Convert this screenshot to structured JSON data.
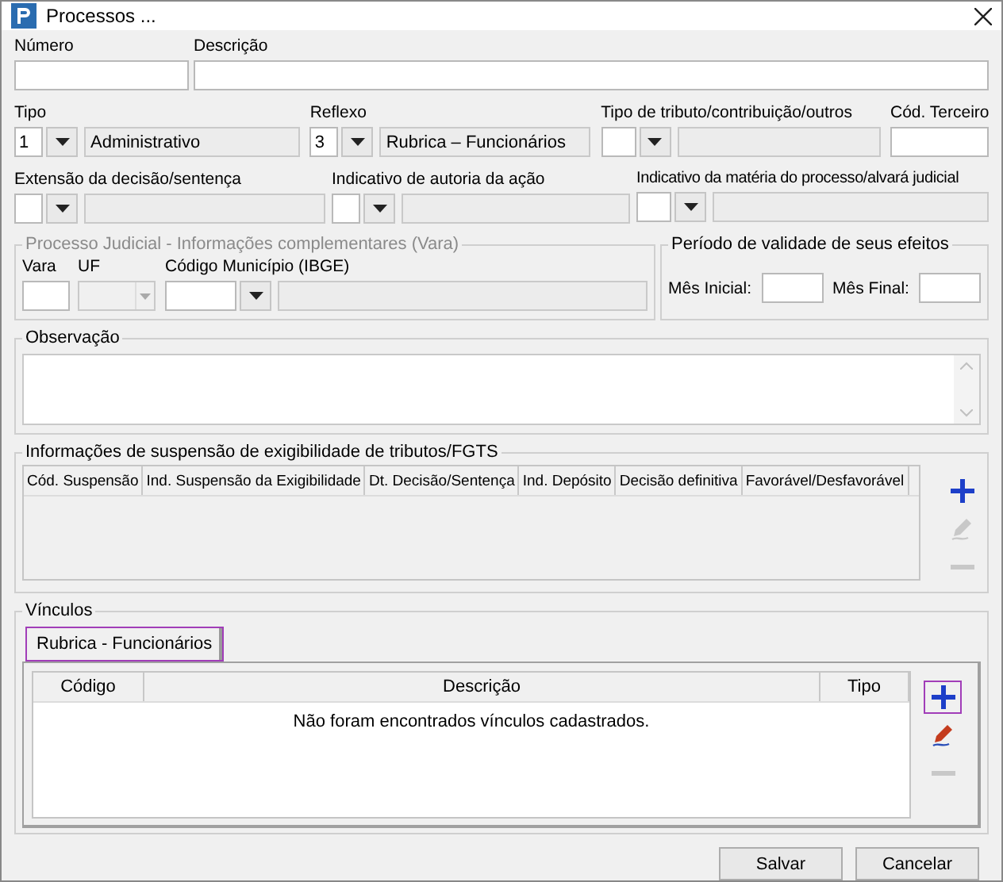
{
  "window": {
    "title": "Processos ..."
  },
  "identification": [
    {
      "label": "Número"
    },
    {
      "label": "Descrição"
    }
  ],
  "row_type": [
    {
      "label": "Tipo",
      "kind": "combo",
      "code": "1",
      "description": "Administrativo"
    },
    {
      "label": "Reflexo",
      "kind": "combo",
      "code": "3",
      "description": "Rubrica – Funcionários"
    },
    {
      "label": "Tipo de tributo/contribuição/outros",
      "kind": "combo"
    },
    {
      "label": "Cód. Terceiro",
      "kind": "text"
    }
  ],
  "row_decision": [
    {
      "label": "Extensão da decisão/sentença",
      "kind": "combo"
    },
    {
      "label": "Indicativo de autoria da ação",
      "kind": "combo"
    },
    {
      "label": "Indicativo da matéria do processo/alvará judicial",
      "kind": "combo"
    }
  ],
  "judicial": {
    "title": "Processo Judicial - Informações complementares (Vara)",
    "disabled": true,
    "fields": [
      {
        "label": "Vara",
        "kind": "text"
      },
      {
        "label": "UF",
        "kind": "select",
        "disabled": true
      },
      {
        "label": "Código Município (IBGE)",
        "kind": "combo"
      }
    ]
  },
  "validity": {
    "title": "Período de validade de seus efeitos",
    "fields": [
      {
        "label": "Mês Inicial:"
      },
      {
        "label": "Mês Final:"
      }
    ]
  },
  "observation": {
    "title": "Observação"
  },
  "suspension": {
    "title": "Informações de suspensão de exigibilidade de tributos/FGTS",
    "columns": [
      "Cód. Suspensão",
      "Ind. Suspensão da Exigibilidade",
      "Dt. Decisão/Sentença",
      "Ind. Depósito",
      "Decisão definitiva",
      "Favorável/Desfavorável"
    ],
    "actions": [
      {
        "kind": "add",
        "disabled": false,
        "highlighted": false
      },
      {
        "kind": "edit",
        "disabled": true,
        "highlighted": false
      },
      {
        "kind": "remove",
        "disabled": true,
        "highlighted": false
      }
    ]
  },
  "links": {
    "title": "Vínculos",
    "tabs": [
      {
        "label": "Rubrica - Funcionários",
        "selected": true,
        "highlighted": true
      }
    ],
    "columns": [
      "Código",
      "Descrição",
      "Tipo"
    ],
    "empty_message": "Não foram encontrados vínculos cadastrados.",
    "actions": [
      {
        "kind": "add",
        "disabled": false,
        "highlighted": true
      },
      {
        "kind": "edit",
        "disabled": false,
        "highlighted": false
      },
      {
        "kind": "remove",
        "disabled": true,
        "highlighted": false
      }
    ]
  },
  "buttons": [
    "Salvar",
    "Cancelar"
  ]
}
